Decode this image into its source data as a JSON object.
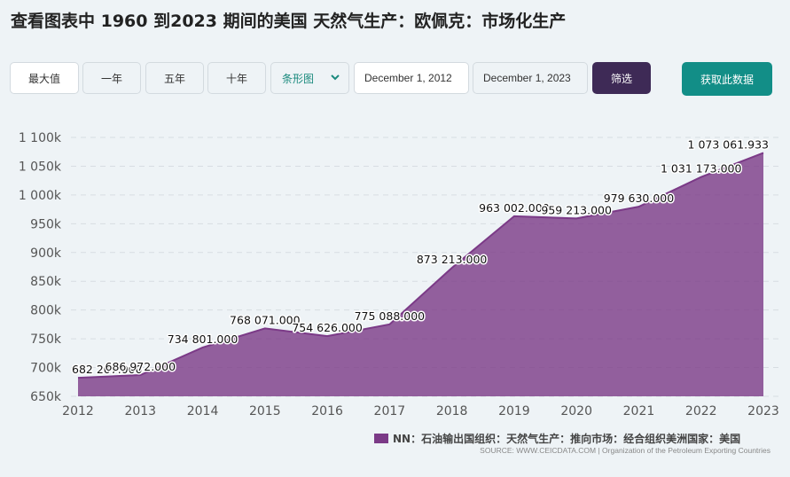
{
  "page": {
    "title": "查看图表中 1960 到2023 期间的美国 天然气生产：欧佩克：市场化生产"
  },
  "toolbar": {
    "range_buttons": [
      "最大值",
      "一年",
      "五年",
      "十年"
    ],
    "chart_type": "条形图",
    "date_from": "December 1, 2012",
    "date_to": "December 1, 2023",
    "filter_label": "筛选",
    "get_data_label": "获取此数据"
  },
  "chart_data": {
    "type": "area",
    "x": [
      "2012",
      "2013",
      "2014",
      "2015",
      "2016",
      "2017",
      "2018",
      "2019",
      "2020",
      "2021",
      "2022",
      "2023"
    ],
    "series": [
      {
        "name": "NN：石油输出国组织：天然气生产：推向市场：经合组织美洲国家：美国",
        "color": "#7b3a87",
        "values": [
          682207.0,
          686972.0,
          734801.0,
          768071.0,
          754626.0,
          775088.0,
          873213.0,
          963002.0,
          959213.0,
          979630.0,
          1031173.0,
          1073061.933
        ]
      }
    ],
    "data_labels": [
      "682 207.000",
      "686 972.000",
      "734 801.000",
      "768 071.000",
      "754 626.000",
      "775 088.000",
      "873 213.000",
      "963 002.000",
      "959 213.000",
      "979 630.000",
      "1 031 173.000",
      "1 073 061.933"
    ],
    "y_ticks": [
      "650k",
      "700k",
      "750k",
      "800k",
      "850k",
      "900k",
      "950k",
      "1 000k",
      "1 050k",
      "1 100k"
    ],
    "x_ticks": [
      "2012",
      "2013",
      "2014",
      "2015",
      "2016",
      "2017",
      "2018",
      "2019",
      "2020",
      "2021",
      "2022",
      "2023"
    ],
    "ylim": [
      650000,
      1100000
    ],
    "grid": true,
    "legend_position": "bottom-right"
  },
  "legend": {
    "label": "NN：石油输出国组织：天然气生产：推向市场：经合组织美洲国家：美国"
  },
  "source": {
    "text": "SOURCE: WWW.CEICDATA.COM | Organization of the Petroleum Exporting Countries"
  }
}
